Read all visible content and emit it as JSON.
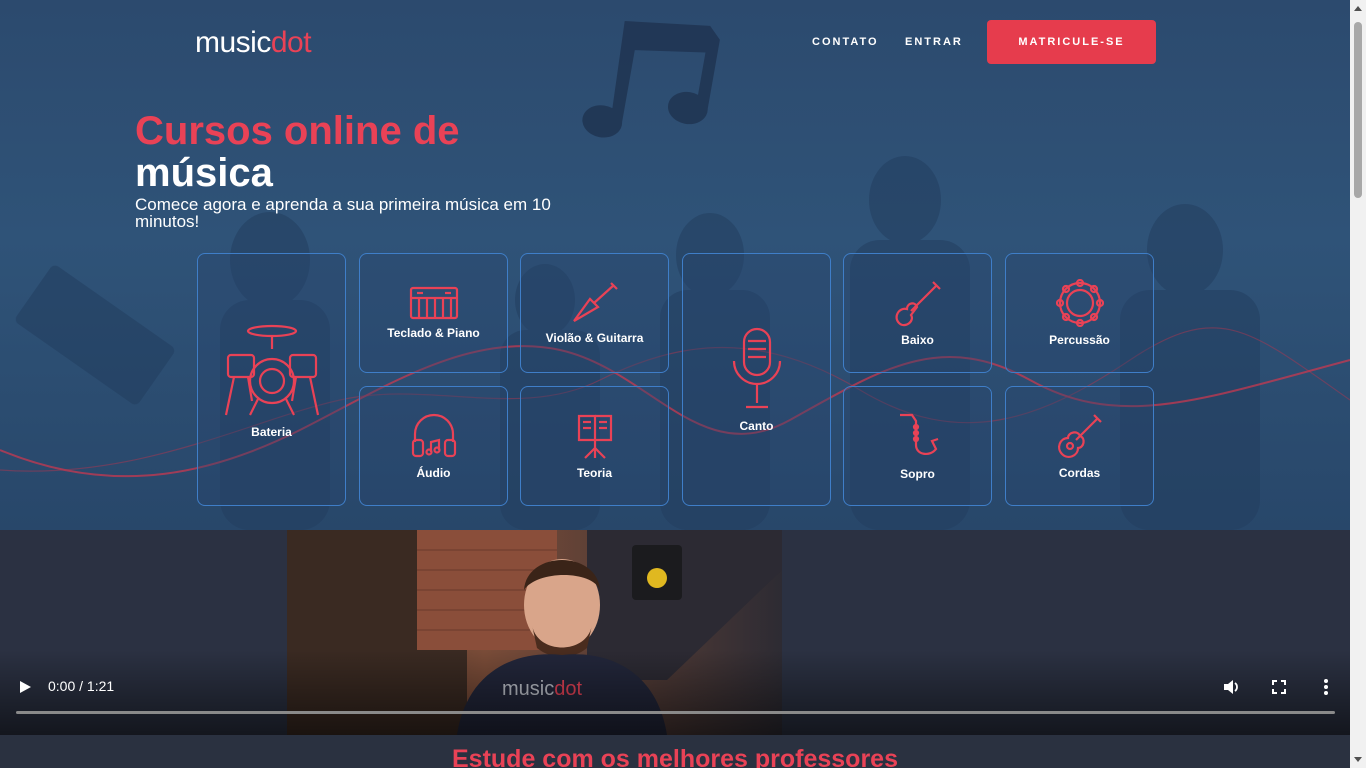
{
  "nav": {
    "logo_text": "music",
    "logo_accent": "dot",
    "links": [
      "CONTATO",
      "ENTRAR"
    ],
    "cta": "MATRICULE-SE"
  },
  "hero": {
    "title_line1": "Cursos online de",
    "title_line2": "música",
    "subtitle": "Comece agora e aprenda a sua primeira música em 10 minutos!"
  },
  "courses": [
    {
      "label": "Bateria",
      "icon": "drum-kit-icon"
    },
    {
      "label": "Teclado & Piano",
      "icon": "keyboard-icon"
    },
    {
      "label": "Violão & Guitarra",
      "icon": "electric-guitar-icon"
    },
    {
      "label": "Canto",
      "icon": "microphone-icon"
    },
    {
      "label": "Baixo",
      "icon": "bass-guitar-icon"
    },
    {
      "label": "Percussão",
      "icon": "tambourine-icon"
    },
    {
      "label": "Áudio",
      "icon": "headphones-icon"
    },
    {
      "label": "Teoria",
      "icon": "music-stand-icon"
    },
    {
      "label": "Sopro",
      "icon": "saxophone-icon"
    },
    {
      "label": "Cordas",
      "icon": "ukulele-icon"
    }
  ],
  "video": {
    "time": "0:00 / 1:21",
    "watermark_text": "music",
    "watermark_accent": "dot"
  },
  "section": {
    "title": "Estude com os melhores professores"
  },
  "colors": {
    "accent": "#e63c4d",
    "card_border": "#3f7ec8",
    "hero_bg": "#2f5378"
  }
}
